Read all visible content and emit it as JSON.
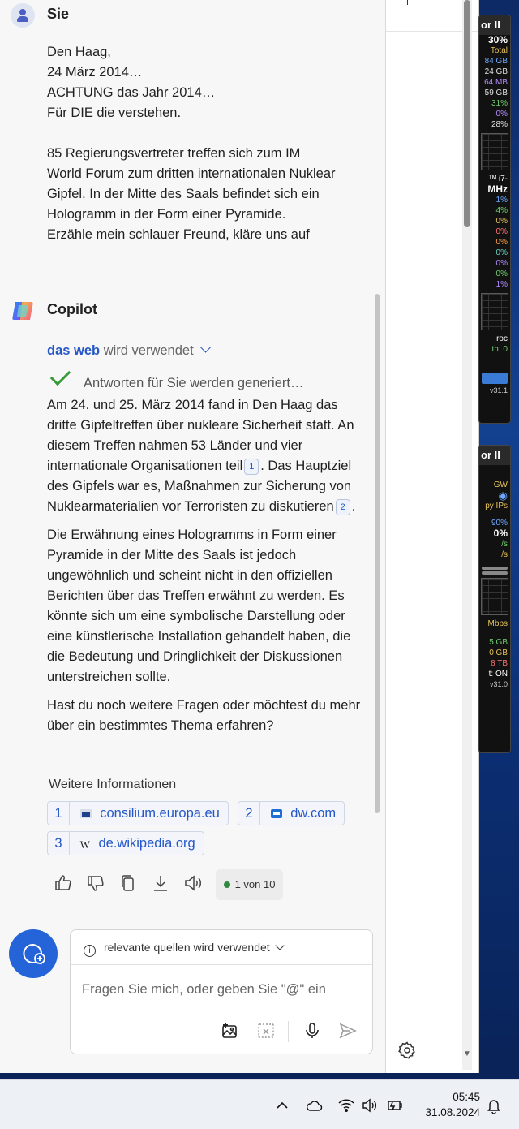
{
  "user": {
    "name": "Sie",
    "message_lines": [
      "Den Haag,",
      "24 März 2014…",
      "ACHTUNG das Jahr 2014…",
      "Für DIE die verstehen.",
      "",
      "85 Regierungsvertreter treffen sich zum IM",
      "World Forum zum dritten internationalen Nuklear",
      "Gipfel. In der Mitte des Saals befindet sich ein",
      "Hologramm in der Form einer Pyramide.",
      "Erzähle mein schlauer Freund, kläre uns auf"
    ]
  },
  "copilot": {
    "name": "Copilot",
    "web_word": "das web",
    "web_rest": "wird verwendet",
    "generating": "Antworten für Sie werden generiert…",
    "p1_a": "Am 24. und 25. März 2014 fand in Den Haag das dritte Gipfeltreffen über nukleare Sicherheit statt. An diesem Treffen nahmen 53 Länder und vier internationale Organisationen teil",
    "p1_cite1": "1",
    "p1_b": ". Das Hauptziel des Gipfels war es, Maßnahmen zur Sicherung von Nuklearmaterialien vor Terroristen zu diskutieren",
    "p1_cite2": "2",
    "p1_c": ".",
    "p2": "Die Erwähnung eines Hologramms in Form einer Pyramide in der Mitte des Saals ist jedoch ungewöhnlich und scheint nicht in den offiziellen Berichten über das Treffen erwähnt zu werden. Es könnte sich um eine symbolische Darstellung oder eine künstlerische Installation gehandelt haben, die die Bedeutung und Dringlichkeit der Diskussionen unterstreichen sollte.",
    "p3": "Hast du noch weitere Fragen oder möchtest du mehr über ein bestimmtes Thema erfahren?",
    "more_info": "Weitere Informationen",
    "sources": [
      {
        "num": "1",
        "domain": "consilium.europa.eu",
        "icon": "consilium-favicon"
      },
      {
        "num": "2",
        "domain": "dw.com",
        "icon": "dw-favicon"
      },
      {
        "num": "3",
        "domain": "de.wikipedia.org",
        "icon": "wikipedia-favicon",
        "glyph": "W"
      }
    ],
    "pager": "1 von 10"
  },
  "composer": {
    "hint": "relevante quellen wird verwendet",
    "placeholder": "Fragen Sie mich, oder geben Sie \"@\" ein"
  },
  "gadget1": {
    "title": "or II",
    "rows": [
      "30%",
      "Total",
      "84 GB",
      "24 GB",
      "64 MB",
      "59 GB",
      "31%",
      "0%",
      "28%"
    ],
    "mid": [
      "ᵀᴹ i7-",
      "MHz",
      "1%",
      "4%",
      "0%",
      "0%",
      "0%",
      "0%",
      "0%",
      "0%",
      "1%"
    ],
    "foot": [
      "roc",
      "th: 0"
    ],
    "ver": "v31.1"
  },
  "gadget2": {
    "title": "or II",
    "rows": [
      "GW",
      "py IPs",
      "90%",
      "0%",
      "/s",
      "/s"
    ],
    "foot": [
      "Mbps",
      "5 GB",
      "0 GB",
      "8 TB",
      "t: ON"
    ],
    "ver": "v31.0"
  },
  "taskbar": {
    "time": "05:45",
    "date": "31.08.2024"
  }
}
